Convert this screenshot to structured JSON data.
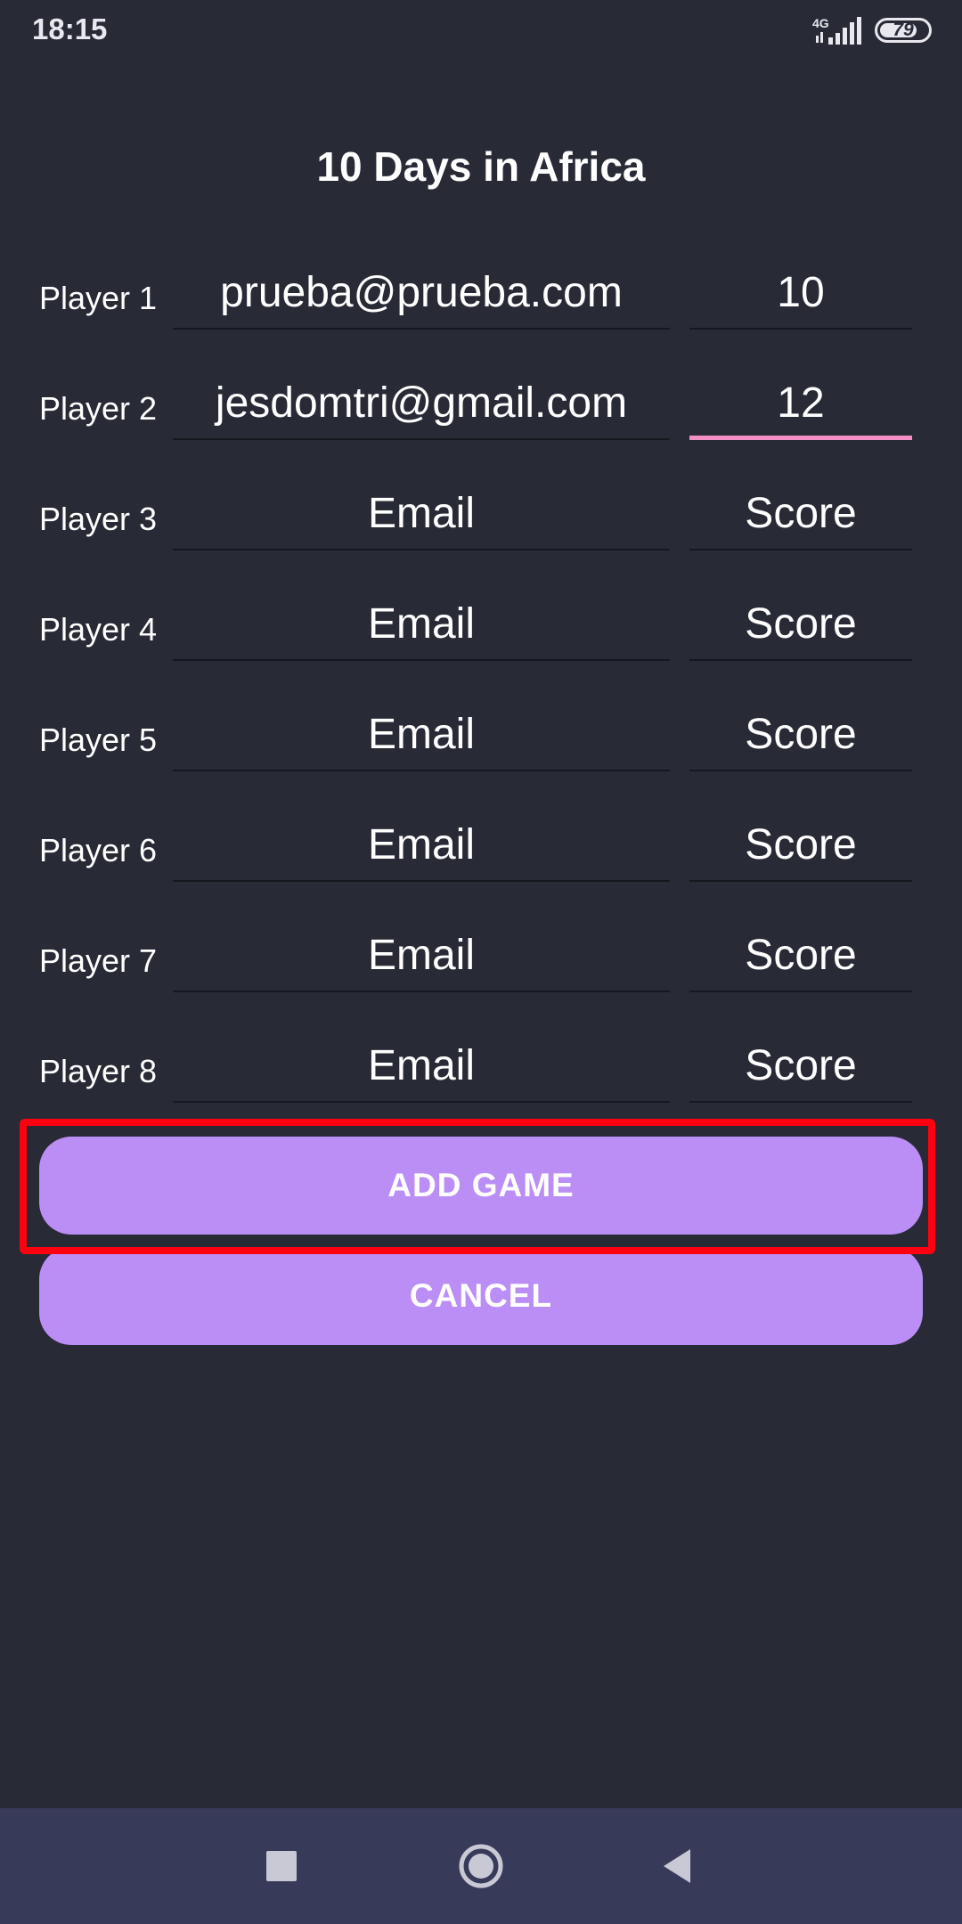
{
  "status": {
    "time": "18:15",
    "network": "4G",
    "battery": "79",
    "battery_level": 0.79
  },
  "page": {
    "title": "10 Days in Africa"
  },
  "players": [
    {
      "label": "Player 1",
      "email": "prueba@prueba.com",
      "score": "10"
    },
    {
      "label": "Player 2",
      "email": "jesdomtri@gmail.com",
      "score": "12"
    },
    {
      "label": "Player 3",
      "email": "Email",
      "score": "Score"
    },
    {
      "label": "Player 4",
      "email": "Email",
      "score": "Score"
    },
    {
      "label": "Player 5",
      "email": "Email",
      "score": "Score"
    },
    {
      "label": "Player 6",
      "email": "Email",
      "score": "Score"
    },
    {
      "label": "Player 7",
      "email": "Email",
      "score": "Score"
    },
    {
      "label": "Player 8",
      "email": "Email",
      "score": "Score"
    }
  ],
  "buttons": {
    "add_game": "ADD GAME",
    "cancel": "CANCEL"
  },
  "nav": {
    "recents_icon": "square-icon",
    "home_icon": "circle-icon",
    "back_icon": "triangle-back-icon"
  },
  "colors": {
    "background": "#282a36",
    "button": "#bb8ef6",
    "focus_underline": "#f48fc5",
    "highlight": "#ff0010",
    "nav_bar": "#383a5a"
  }
}
